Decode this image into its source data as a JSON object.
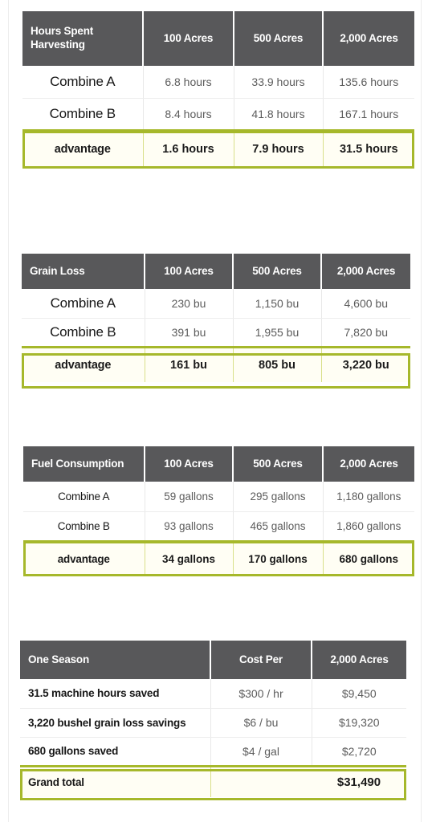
{
  "colors": {
    "header_bg": "#58585a",
    "header_text": "#ffffff",
    "highlight_border": "#a6b82b",
    "highlight_fill": "#fffef4",
    "body_text": "#5c5c5c",
    "label_text": "#161616",
    "page_bg": "#ffffff"
  },
  "tables": [
    {
      "id": "hours",
      "title": "Hours Spent Harvesting",
      "columns": [
        "Hours Spent Harvesting",
        "100 Acres",
        "500 Acres",
        "2,000 Acres"
      ],
      "rows": [
        {
          "label": "Combine A",
          "values": [
            "6.8 hours",
            "33.9 hours",
            "135.6 hours"
          ],
          "highlight": false
        },
        {
          "label": "Combine B",
          "values": [
            "8.4 hours",
            "41.8 hours",
            "167.1 hours"
          ],
          "highlight": false
        },
        {
          "label": "advantage",
          "values": [
            "1.6 hours",
            "7.9 hours",
            "31.5 hours"
          ],
          "highlight": true
        }
      ]
    },
    {
      "id": "grain",
      "title": "Grain Loss",
      "columns": [
        "Grain Loss",
        "100 Acres",
        "500 Acres",
        "2,000 Acres"
      ],
      "rows": [
        {
          "label": "Combine A",
          "values": [
            "230 bu",
            "1,150 bu",
            "4,600 bu"
          ],
          "highlight": false
        },
        {
          "label": "Combine B",
          "values": [
            "391 bu",
            "1,955 bu",
            "7,820 bu"
          ],
          "highlight": false
        },
        {
          "label": "advantage",
          "values": [
            "161 bu",
            "805 bu",
            "3,220 bu"
          ],
          "highlight": true
        }
      ]
    },
    {
      "id": "fuel",
      "title": "Fuel Consumption",
      "columns": [
        "Fuel Consumption",
        "100 Acres",
        "500 Acres",
        "2,000 Acres"
      ],
      "rows": [
        {
          "label": "Combine A",
          "values": [
            "59 gallons",
            "295 gallons",
            "1,180 gallons"
          ],
          "highlight": false
        },
        {
          "label": "Combine B",
          "values": [
            "93 gallons",
            "465 gallons",
            "1,860 gallons"
          ],
          "highlight": false
        },
        {
          "label": "advantage",
          "values": [
            "34 gallons",
            "170 gallons",
            "680 gallons"
          ],
          "highlight": true
        }
      ]
    },
    {
      "id": "season",
      "title": "One Season",
      "columns": [
        "One Season",
        "Cost Per",
        "2,000 Acres"
      ],
      "rows": [
        {
          "label": "31.5 machine hours saved",
          "values": [
            "$300 / hr",
            "$9,450"
          ],
          "highlight": false
        },
        {
          "label": "3,220 bushel grain loss savings",
          "values": [
            "$6 / bu",
            "$19,320"
          ],
          "highlight": false
        },
        {
          "label": "680 gallons saved",
          "values": [
            "$4 / gal",
            "$2,720"
          ],
          "highlight": false
        },
        {
          "label": "Grand total",
          "values": [
            "",
            "$31,490"
          ],
          "highlight": true
        }
      ]
    }
  ],
  "chart_data": {
    "type": "table",
    "title": "Combine A vs Combine B comparison and one-season savings",
    "tables": [
      {
        "name": "Hours Spent Harvesting",
        "unit": "hours",
        "categories": [
          "100 Acres",
          "500 Acres",
          "2,000 Acres"
        ],
        "series": [
          {
            "name": "Combine A",
            "values": [
              6.8,
              33.9,
              135.6
            ]
          },
          {
            "name": "Combine B",
            "values": [
              8.4,
              41.8,
              167.1
            ]
          },
          {
            "name": "advantage",
            "values": [
              1.6,
              7.9,
              31.5
            ]
          }
        ]
      },
      {
        "name": "Grain Loss",
        "unit": "bu",
        "categories": [
          "100 Acres",
          "500 Acres",
          "2,000 Acres"
        ],
        "series": [
          {
            "name": "Combine A",
            "values": [
              230,
              1150,
              4600
            ]
          },
          {
            "name": "Combine B",
            "values": [
              391,
              1955,
              7820
            ]
          },
          {
            "name": "advantage",
            "values": [
              161,
              805,
              3220
            ]
          }
        ]
      },
      {
        "name": "Fuel Consumption",
        "unit": "gallons",
        "categories": [
          "100 Acres",
          "500 Acres",
          "2,000 Acres"
        ],
        "series": [
          {
            "name": "Combine A",
            "values": [
              59,
              295,
              1180
            ]
          },
          {
            "name": "Combine B",
            "values": [
              93,
              465,
              1860
            ]
          },
          {
            "name": "advantage",
            "values": [
              34,
              170,
              680
            ]
          }
        ]
      },
      {
        "name": "One Season",
        "unit": "USD",
        "columns": [
          "One Season",
          "Cost Per",
          "2,000 Acres"
        ],
        "rows": [
          {
            "item": "31.5 machine hours saved",
            "cost_per": "$300 / hr",
            "amount": 9450
          },
          {
            "item": "3,220 bushel grain loss savings",
            "cost_per": "$6 / bu",
            "amount": 19320
          },
          {
            "item": "680 gallons saved",
            "cost_per": "$4 / gal",
            "amount": 2720
          },
          {
            "item": "Grand total",
            "cost_per": "",
            "amount": 31490
          }
        ]
      }
    ]
  }
}
